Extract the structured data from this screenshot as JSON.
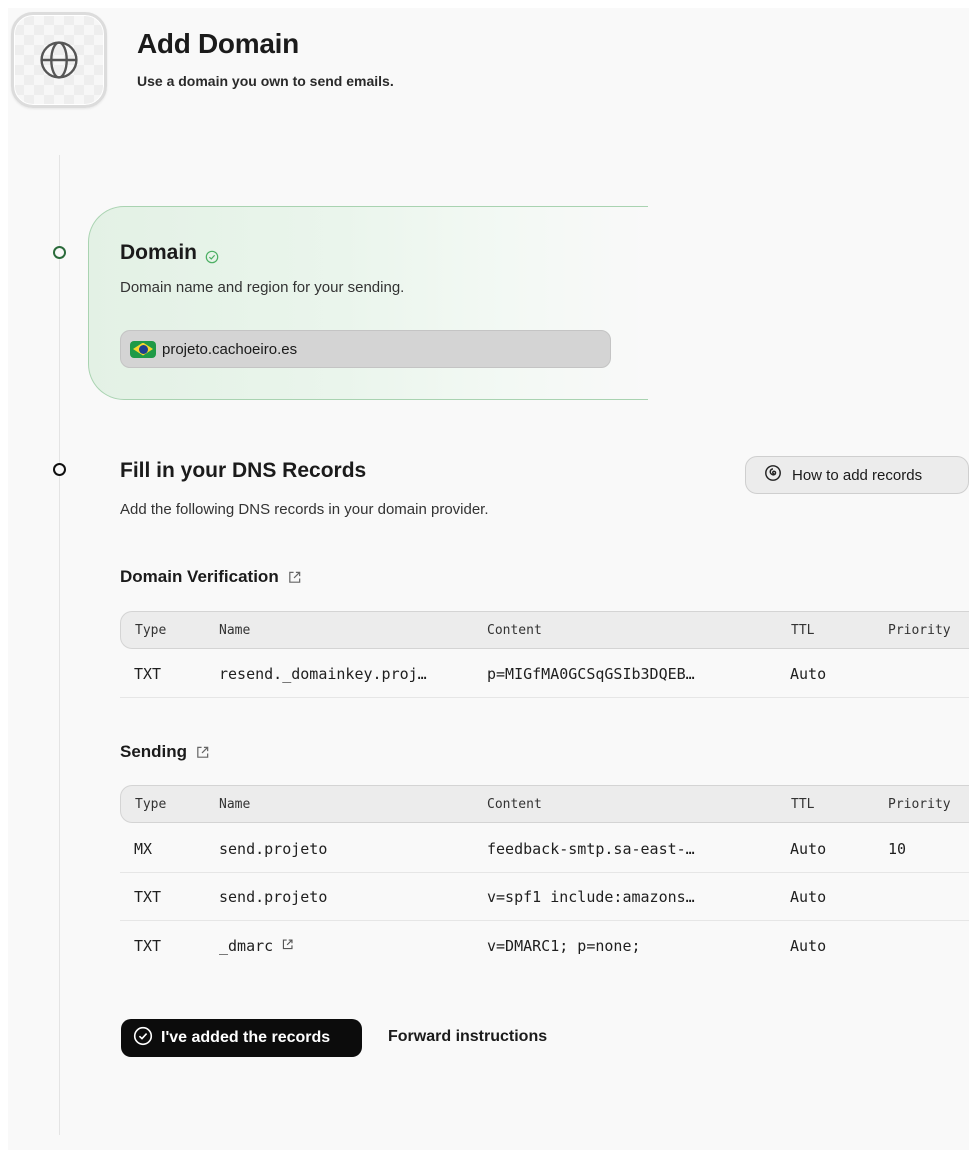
{
  "header": {
    "title": "Add Domain",
    "subtitle": "Use a domain you own to send emails."
  },
  "domain_step": {
    "title": "Domain",
    "description": "Domain name and region for your sending.",
    "domain_value": "projeto.cachoeiro.es",
    "status": "complete"
  },
  "dns_step": {
    "title": "Fill in your DNS Records",
    "description": "Add the following DNS records in your domain provider.",
    "how_to_label": "How to add records"
  },
  "columns": {
    "type": "Type",
    "name": "Name",
    "content": "Content",
    "ttl": "TTL",
    "priority": "Priority"
  },
  "verification": {
    "heading": "Domain Verification",
    "rows": [
      {
        "type": "TXT",
        "name": "resend._domainkey.proj…",
        "content": "p=MIGfMA0GCSqGSIb3DQEB…",
        "ttl": "Auto",
        "priority": ""
      }
    ]
  },
  "sending": {
    "heading": "Sending",
    "rows": [
      {
        "type": "MX",
        "name": "send.projeto",
        "content": "feedback-smtp.sa-east-…",
        "ttl": "Auto",
        "priority": "10"
      },
      {
        "type": "TXT",
        "name": "send.projeto",
        "content": "v=spf1 include:amazons…",
        "ttl": "Auto",
        "priority": ""
      },
      {
        "type": "TXT",
        "name": "_dmarc",
        "content": "v=DMARC1; p=none;",
        "ttl": "Auto",
        "priority": ""
      }
    ]
  },
  "actions": {
    "confirm_label": "I've added the records",
    "forward_label": "Forward instructions"
  },
  "colors": {
    "accent_green": "#2b6b3b",
    "card_border": "#a9d3b1",
    "primary_button": "#0c0c0c"
  }
}
